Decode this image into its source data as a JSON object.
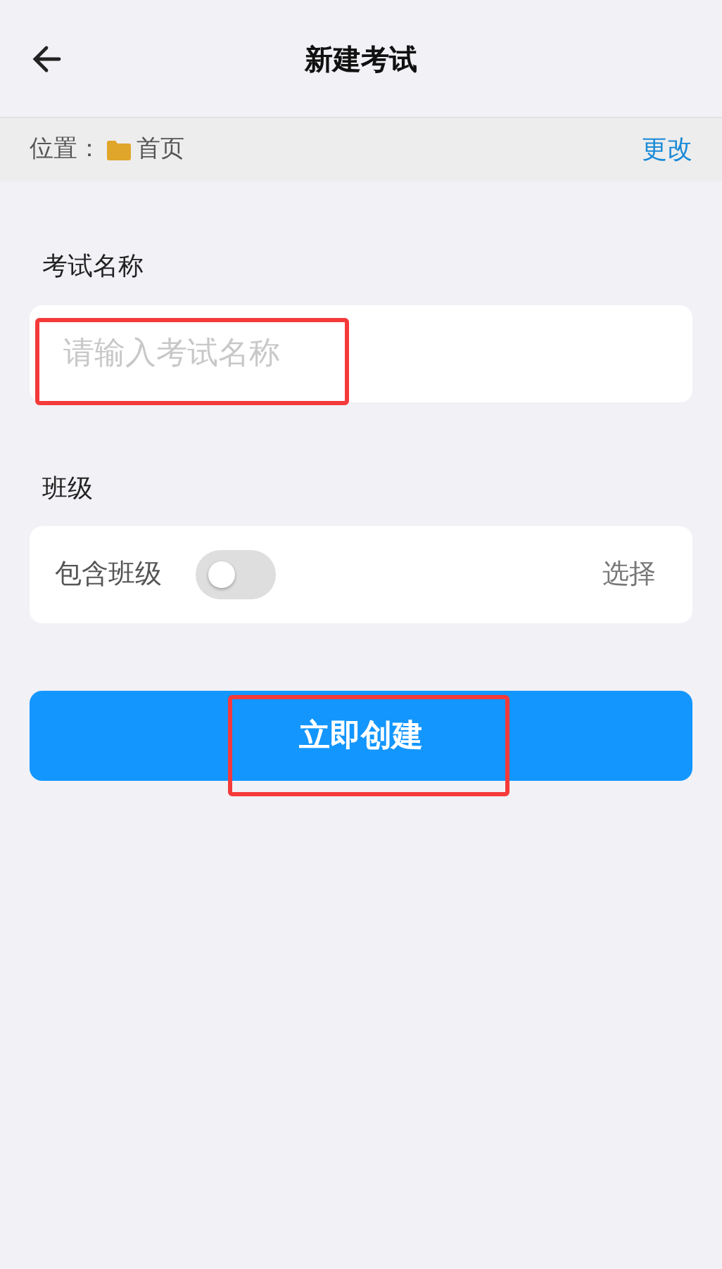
{
  "header": {
    "title": "新建考试"
  },
  "location": {
    "label": "位置：",
    "folder": "首页",
    "change_link": "更改"
  },
  "exam_name": {
    "label": "考试名称",
    "placeholder": "请输入考试名称",
    "highlighted": true
  },
  "class_section": {
    "label": "班级",
    "toggle_label": "包含班级",
    "on": false,
    "select_link": "选择"
  },
  "create_button": {
    "label": "立即创建",
    "highlighted": true
  }
}
